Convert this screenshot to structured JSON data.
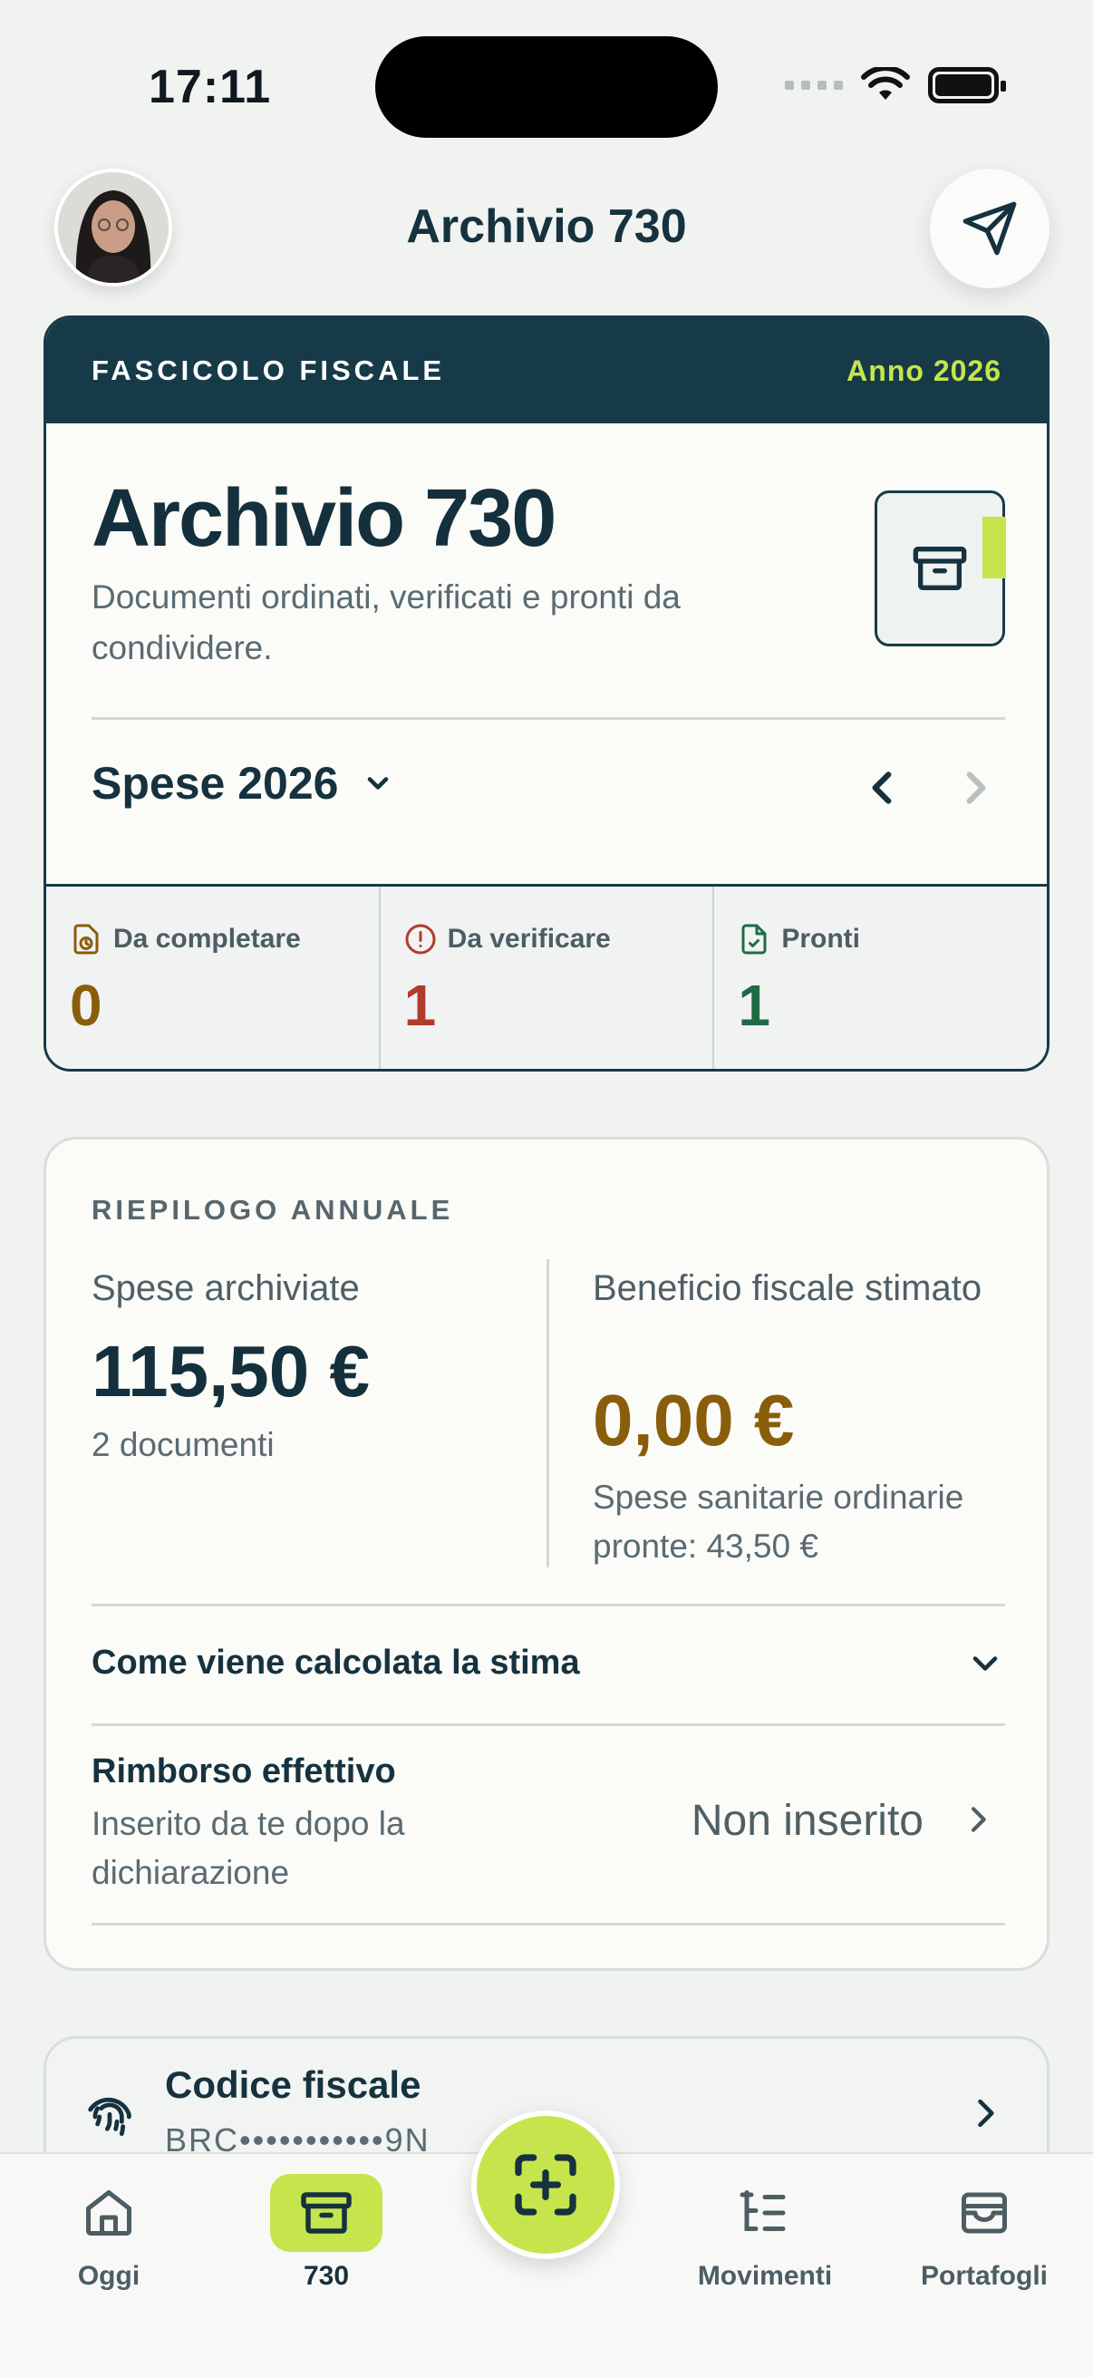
{
  "status_bar": {
    "time": "17:11"
  },
  "header": {
    "title": "Archivio 730"
  },
  "fascicolo": {
    "label": "FASCICOLO FISCALE",
    "year": "Anno 2026",
    "title": "Archivio 730",
    "subtitle": "Documenti ordinati, verificati e pronti da condividere.",
    "period_selector": "Spese 2026",
    "stats": [
      {
        "label": "Da completare",
        "value": "0",
        "color": "#8a5d0b",
        "icon": "clock-document-icon"
      },
      {
        "label": "Da verificare",
        "value": "1",
        "color": "#b23a2e",
        "icon": "alert-circle-icon"
      },
      {
        "label": "Pronti",
        "value": "1",
        "color": "#1f6b45",
        "icon": "check-document-icon"
      }
    ]
  },
  "summary": {
    "label": "RIEPILOGO ANNUALE",
    "archived_title": "Spese archiviate",
    "archived_value": "115,50 €",
    "archived_sub": "2 documenti",
    "benefit_title": "Beneficio fiscale stimato",
    "benefit_value": "0,00 €",
    "benefit_sub": "Spese sanitarie ordinarie pronte: 43,50 €",
    "calc_title": "Come viene calcolata la stima",
    "refund_title": "Rimborso effettivo",
    "refund_sub": "Inserito da te dopo la dichiarazione",
    "refund_value": "Non inserito"
  },
  "codice_fiscale": {
    "title": "Codice fiscale",
    "value": "BRC•••••••••••9N"
  },
  "tabbar": {
    "tabs": [
      {
        "label": "Oggi",
        "icon": "home-icon"
      },
      {
        "label": "730",
        "icon": "archive-icon",
        "active": true
      },
      {
        "label": "Movimenti",
        "icon": "list-tree-icon"
      },
      {
        "label": "Portafogli",
        "icon": "wallet-icon"
      }
    ],
    "scan_icon": "scan-add-icon"
  },
  "colors": {
    "primary_dark": "#173a48",
    "accent_lime": "#c6e54c",
    "amber": "#8a5d0b",
    "red": "#b23a2e",
    "green": "#1f6b45"
  }
}
